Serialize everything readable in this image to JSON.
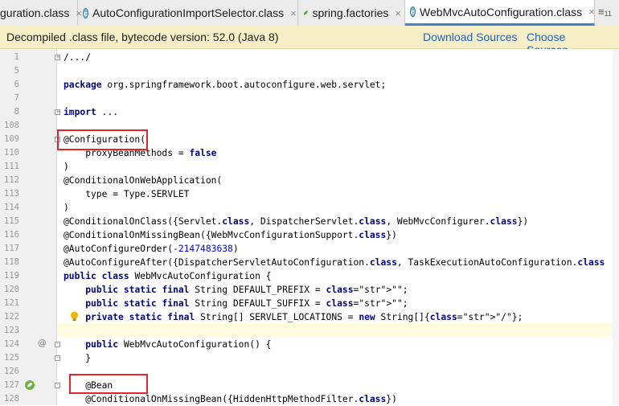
{
  "tabs": [
    {
      "label": "guration.class",
      "close": "×",
      "icon": "class-icon"
    },
    {
      "label": "AutoConfigurationImportSelector.class",
      "close": "×",
      "icon": "class-icon"
    },
    {
      "label": "spring.factories",
      "close": "×",
      "icon": "spring-leaf-icon"
    },
    {
      "label": "WebMvcAutoConfiguration.class",
      "close": "×",
      "icon": "class-icon",
      "active": true
    }
  ],
  "tab_overflow": "≡",
  "tab_overflow_count": "11",
  "banner": {
    "message": "Decompiled .class file, bytecode version: 52.0 (Java 8)",
    "download_sources": "Download Sources",
    "choose_sources": "Choose Sources..."
  },
  "lines": [
    {
      "n": "1",
      "text": "/.../"
    },
    {
      "n": "5",
      "text": ""
    },
    {
      "n": "6",
      "text": "package org.springframework.boot.autoconfigure.web.servlet;"
    },
    {
      "n": "7",
      "text": ""
    },
    {
      "n": "8",
      "text": "import ..."
    },
    {
      "n": "108",
      "text": ""
    },
    {
      "n": "109",
      "text": "@Configuration("
    },
    {
      "n": "110",
      "text": "    proxyBeanMethods = false"
    },
    {
      "n": "111",
      "text": ")"
    },
    {
      "n": "112",
      "text": "@ConditionalOnWebApplication("
    },
    {
      "n": "113",
      "text": "    type = Type.SERVLET"
    },
    {
      "n": "114",
      "text": ")"
    },
    {
      "n": "115",
      "text": "@ConditionalOnClass({Servlet.class, DispatcherServlet.class, WebMvcConfigurer.class})"
    },
    {
      "n": "116",
      "text": "@ConditionalOnMissingBean({WebMvcConfigurationSupport.class})"
    },
    {
      "n": "117",
      "text": "@AutoConfigureOrder(-2147483638)"
    },
    {
      "n": "118",
      "text": "@AutoConfigureAfter({DispatcherServletAutoConfiguration.class, TaskExecutionAutoConfiguration.class"
    },
    {
      "n": "119",
      "text": "public class WebMvcAutoConfiguration {"
    },
    {
      "n": "120",
      "text": "    public static final String DEFAULT_PREFIX = \"\";"
    },
    {
      "n": "121",
      "text": "    public static final String DEFAULT_SUFFIX = \"\";"
    },
    {
      "n": "122",
      "text": "    private static final String[] SERVLET_LOCATIONS = new String[]{\"/\"};"
    },
    {
      "n": "123",
      "text": ""
    },
    {
      "n": "124",
      "text": "    public WebMvcAutoConfiguration() {"
    },
    {
      "n": "125",
      "text": "    }"
    },
    {
      "n": "126",
      "text": ""
    },
    {
      "n": "127",
      "text": "    @Bean"
    },
    {
      "n": "128",
      "text": "    @ConditionalOnMissingBean({HiddenHttpMethodFilter.class})"
    }
  ],
  "gutter_marks": {
    "override": "@"
  },
  "colors": {
    "highlight_box": "#e0262b",
    "keyword": "#000080",
    "string": "#008000",
    "number": "#0000ff",
    "banner_bg": "#f5eec7"
  }
}
